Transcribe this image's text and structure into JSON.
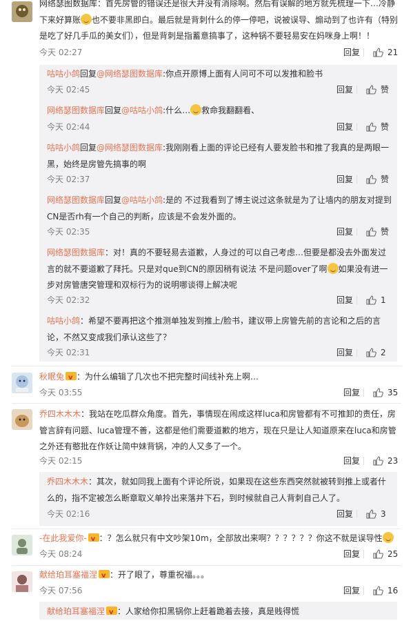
{
  "labels": {
    "reply": "回复",
    "like": "赞",
    "reply_to": "回复",
    "at_sign": "@"
  },
  "c1": {
    "text": "网络瑟图数据库：首先房管的错误还是很大并没有消除啊。然后有误解的地方就先梳理一下…冷静下来好算账",
    "text2": "也不要非黑即白。最后就是背刺什么的停一停吧，说被误导、煽动到了也许有（特别是吃了好几手瓜的美女们），但是背刺是指蓄意搞事了，这种锅不要轻易安在妈咪身上啊！！",
    "time": "今天 02:27",
    "likes": "21"
  },
  "r1": {
    "user": "咕咕小鸽",
    "target": "网络瑟图数据库",
    "text": ":你点开原博上面有人问可不可以发推和脸书",
    "time": "今天 02:45"
  },
  "r2": {
    "user": "网络瑟图数据库",
    "target": "咕咕小鸽",
    "text": ":什么…",
    "text2": "救命我翻翻看、",
    "time": "今天 02:44"
  },
  "r3": {
    "user": "咕咕小鸽",
    "target": "网络瑟图数据库",
    "text": ":我刚刚看上面的评论已经有人要发脸书和推了我真的是两眼一黑，始终是房管先搞事的啊",
    "time": "今天 02:37"
  },
  "r4": {
    "user": "网络瑟图数据库",
    "target": "咕咕小鸽",
    "text": ":是的 不过我看到了博主说过这条就是为了让墙内的朋友对提到CN是否rh有一个自己的判断，应该是不会发外面的。",
    "time": "今天 02:35"
  },
  "r5": {
    "user": "网络瑟图数据库",
    "text": "：对！真的不要轻易去道歉，人身过的可以自己考虑…但要是都没去外面发过言的就不要道歉了拜托。只是对que到CN的原因稍有说法 不是问题over了啊",
    "text2": "如果没有进一步对房管唐突管理和双标行为的说明哪谈得上解决呢",
    "time": "今天 02:32",
    "likes": "1"
  },
  "r6": {
    "user": "咕咕小鸽",
    "text": "：希望不要再把这个推测单独发到推上/脸书，建议带上房管先前的言论和之后的言论，不然又变成我们承认这些了？",
    "time": "今天 02:31",
    "likes": "2"
  },
  "c2": {
    "user": "秋眠兔",
    "text": "：为什么编辑了几次也不把完整时间线补充上啊…",
    "time": "今天 03:55",
    "likes": "35"
  },
  "c3": {
    "user": "乔四木木木",
    "text": "：我站在吃瓜群众角度。首先，事情现在闹成这样luca和房管都有不可推卸的责任，房管言辞有问题、luca管理不善，这都是他们需要道歉的地方，现在只是让人知道原来在luca和房管之外还有憨批在作妖让简中妹背锅，冲的人又多了一个。",
    "time": "今天 02:15",
    "likes": "23"
  },
  "r7": {
    "user": "乔四木木木",
    "text": "：其次，就如同我上面有个评论所说，如果现在这些东西突然就被转到推上或者什么的，指不定被怎么断章取义单拎出来落井下石，到时候就自己人背刺自己人了。",
    "time": "今天 02:16",
    "likes": "3"
  },
  "c4": {
    "user": "-在此我爱你-",
    "text": "：？怎么就只有中文吵架10m，全部放出来啊？？？？？？你这不就是误导性",
    "time": "今天 08:24",
    "likes": "25"
  },
  "c5": {
    "user": "献给珀耳塞福涅",
    "text": "：开了眼了，尊重祝福。。。",
    "time": "今天 07:56",
    "likes": "16"
  },
  "r8": {
    "user": "献给珀耳塞福涅",
    "text": "：人家给你扣黑锅你上赶着跪着去接，真是贱得慌"
  }
}
